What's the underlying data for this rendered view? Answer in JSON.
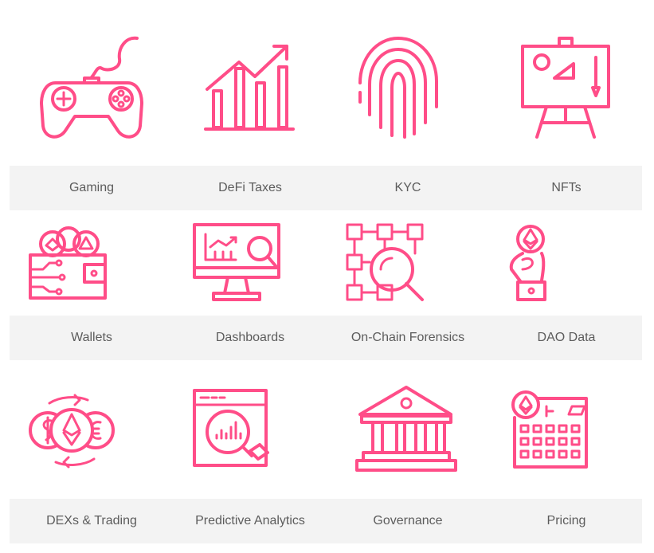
{
  "accent_color": "#ff4d88",
  "band_color": "#f3f3f3",
  "categories": [
    {
      "label": "Gaming",
      "icon": "gamepad-icon"
    },
    {
      "label": "DeFi Taxes",
      "icon": "bar-chart-growth-icon"
    },
    {
      "label": "KYC",
      "icon": "fingerprint-icon"
    },
    {
      "label": "NFTs",
      "icon": "easel-art-icon"
    },
    {
      "label": "Wallets",
      "icon": "crypto-wallet-icon"
    },
    {
      "label": "Dashboards",
      "icon": "monitor-analytics-icon"
    },
    {
      "label": "On-Chain Forensics",
      "icon": "blockchain-search-icon"
    },
    {
      "label": "DAO Data",
      "icon": "hand-ethereum-icon"
    },
    {
      "label": "DEXs & Trading",
      "icon": "coin-exchange-icon"
    },
    {
      "label": "Predictive Analytics",
      "icon": "analytics-magnifier-icon"
    },
    {
      "label": "Governance",
      "icon": "government-building-icon"
    },
    {
      "label": "Pricing",
      "icon": "ethereum-calculator-icon"
    }
  ]
}
